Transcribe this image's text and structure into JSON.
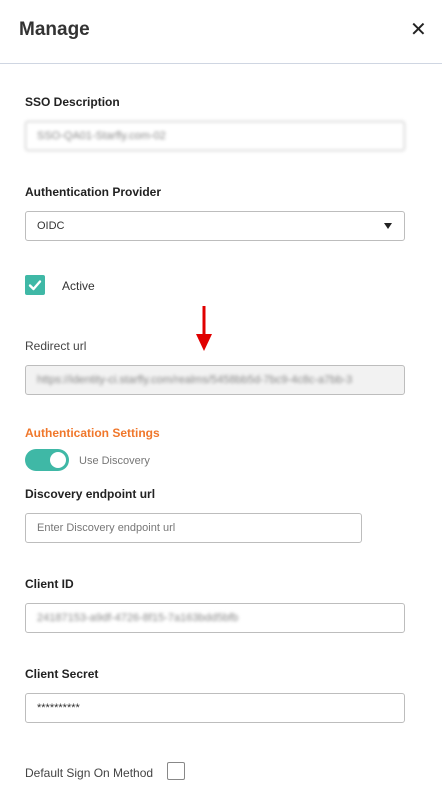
{
  "header": {
    "title": "Manage",
    "close_label": "✕"
  },
  "sso": {
    "label": "SSO Description",
    "value": "SSO-QA01-Starfly.com-02"
  },
  "provider": {
    "label": "Authentication Provider",
    "value": "OIDC"
  },
  "active": {
    "label": "Active",
    "checked": true
  },
  "redirect": {
    "label": "Redirect url",
    "value": "https://identity-ci.starfly.com/realms/5458bb5d-7bc9-4c8c-a7bb-3"
  },
  "auth_settings": {
    "heading": "Authentication Settings",
    "use_discovery_label": "Use Discovery",
    "use_discovery_on": true
  },
  "discovery": {
    "label": "Discovery endpoint url",
    "placeholder": "Enter Discovery endpoint url"
  },
  "client_id": {
    "label": "Client ID",
    "value": "24187153-a9df-4726-8f15-7a163bdd5bfb"
  },
  "client_secret": {
    "label": "Client Secret",
    "value": "**********"
  },
  "default_sign_on": {
    "label": "Default Sign On Method",
    "checked": false
  },
  "colors": {
    "accent": "#3fb8a6",
    "section_heading": "#f0772b",
    "annotation_arrow": "#e00000"
  }
}
